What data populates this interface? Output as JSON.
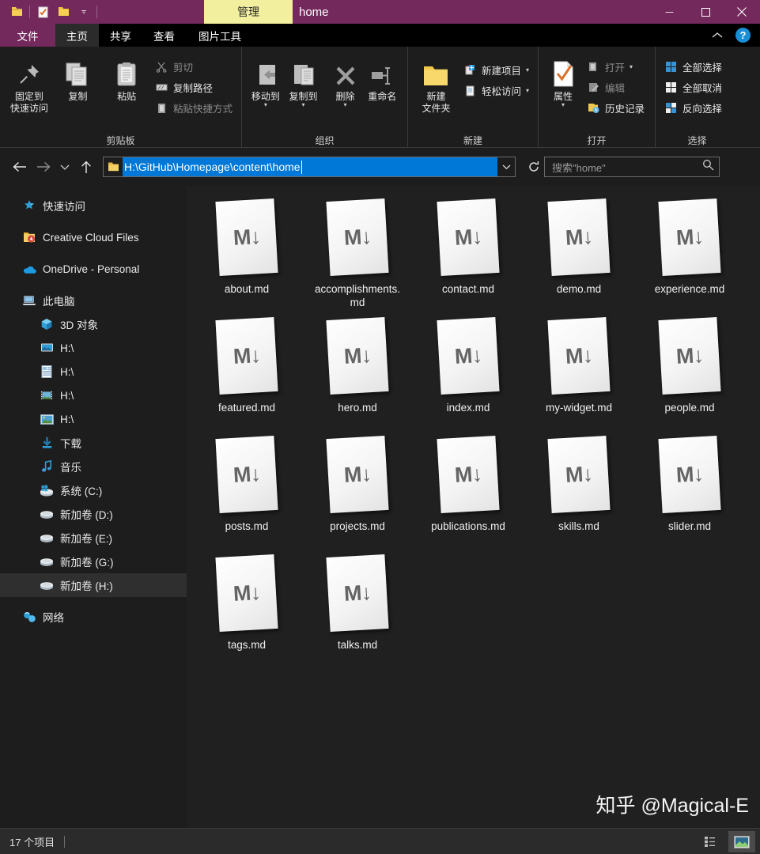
{
  "titlebar": {
    "quick_access": [
      "folder-icon",
      "properties-icon",
      "new-folder-icon",
      "customize-dropdown-icon"
    ],
    "contextual_tab": "管理",
    "window_title": "home",
    "minimize": "minimize-icon",
    "maximize": "maximize-icon",
    "close": "close-icon"
  },
  "ribbon_tabs": {
    "file": "文件",
    "items": [
      {
        "label": "主页",
        "active": true
      },
      {
        "label": "共享",
        "active": false
      },
      {
        "label": "查看",
        "active": false
      },
      {
        "label": "图片工具",
        "active": false
      }
    ],
    "collapse": "chevron-up-icon",
    "help": "?"
  },
  "ribbon": {
    "groups": [
      {
        "name": "剪贴板",
        "big": [
          {
            "label_line1": "固定到",
            "label_line2": "快速访问",
            "icon": "pin-icon"
          },
          {
            "label_line1": "复制",
            "label_line2": "",
            "icon": "copy-icon"
          },
          {
            "label_line1": "粘贴",
            "label_line2": "",
            "icon": "paste-icon"
          }
        ],
        "small": [
          {
            "label": "剪切",
            "icon": "scissors-icon",
            "disabled": true
          },
          {
            "label": "复制路径",
            "icon": "copy-path-icon",
            "disabled": false
          },
          {
            "label": "粘贴快捷方式",
            "icon": "paste-shortcut-icon",
            "disabled": true
          }
        ]
      },
      {
        "name": "组织",
        "big": [
          {
            "label_line1": "移动到",
            "label_line2": "",
            "icon": "move-to-icon",
            "dropdown": true
          },
          {
            "label_line1": "复制到",
            "label_line2": "",
            "icon": "copy-to-icon",
            "dropdown": true
          },
          {
            "label_line1": "删除",
            "label_line2": "",
            "icon": "delete-icon",
            "dropdown": true
          },
          {
            "label_line1": "重命名",
            "label_line2": "",
            "icon": "rename-icon"
          }
        ],
        "small": []
      },
      {
        "name": "新建",
        "big": [
          {
            "label_line1": "新建",
            "label_line2": "文件夹",
            "icon": "new-folder-icon"
          }
        ],
        "small": [
          {
            "label": "新建项目",
            "icon": "new-item-icon",
            "dropdown": true,
            "disabled": false
          },
          {
            "label": "轻松访问",
            "icon": "easy-access-icon",
            "dropdown": true,
            "disabled": false
          }
        ]
      },
      {
        "name": "打开",
        "big": [
          {
            "label_line1": "属性",
            "label_line2": "",
            "icon": "properties-icon",
            "dropdown": true
          }
        ],
        "small": [
          {
            "label": "打开",
            "icon": "open-icon",
            "dropdown": true,
            "disabled": true
          },
          {
            "label": "编辑",
            "icon": "edit-icon",
            "disabled": true
          },
          {
            "label": "历史记录",
            "icon": "history-icon",
            "disabled": false
          }
        ]
      },
      {
        "name": "选择",
        "big": [],
        "small": [
          {
            "label": "全部选择",
            "icon": "select-all-icon",
            "disabled": false
          },
          {
            "label": "全部取消",
            "icon": "select-none-icon",
            "disabled": false
          },
          {
            "label": "反向选择",
            "icon": "invert-selection-icon",
            "disabled": false
          }
        ]
      }
    ]
  },
  "addressbar": {
    "back": "back-arrow-icon",
    "forward": "forward-arrow-icon",
    "recent": "chevron-down-icon",
    "up": "up-arrow-icon",
    "path_icon": "folder-icon",
    "path": "H:\\GitHub\\Homepage\\content\\home",
    "dropdown": "chevron-down-icon",
    "refresh": "refresh-icon",
    "search_placeholder": "搜索\"home\"",
    "search_value": "",
    "search_icon": "search-icon"
  },
  "sidebar": {
    "items": [
      {
        "label": "快速访问",
        "icon": "star-pin-icon",
        "indent": false,
        "selected": false,
        "space_before": false
      },
      {
        "label": "Creative Cloud Files",
        "icon": "creative-cloud-icon",
        "indent": false,
        "selected": false,
        "space_before": true
      },
      {
        "label": "OneDrive - Personal",
        "icon": "onedrive-icon",
        "indent": false,
        "selected": false,
        "space_before": true
      },
      {
        "label": "此电脑",
        "icon": "this-pc-icon",
        "indent": false,
        "selected": false,
        "space_before": true
      },
      {
        "label": "3D 对象",
        "icon": "3d-objects-icon",
        "indent": true,
        "selected": false,
        "space_before": false
      },
      {
        "label": "H:\\",
        "icon": "desktop-icon",
        "indent": true,
        "selected": false,
        "space_before": false
      },
      {
        "label": "H:\\",
        "icon": "documents-icon",
        "indent": true,
        "selected": false,
        "space_before": false
      },
      {
        "label": "H:\\",
        "icon": "videos-icon",
        "indent": true,
        "selected": false,
        "space_before": false
      },
      {
        "label": "H:\\",
        "icon": "pictures-icon",
        "indent": true,
        "selected": false,
        "space_before": false
      },
      {
        "label": "下载",
        "icon": "downloads-icon",
        "indent": true,
        "selected": false,
        "space_before": false
      },
      {
        "label": "音乐",
        "icon": "music-icon",
        "indent": true,
        "selected": false,
        "space_before": false
      },
      {
        "label": "系统 (C:)",
        "icon": "system-drive-icon",
        "indent": true,
        "selected": false,
        "space_before": false
      },
      {
        "label": "新加卷 (D:)",
        "icon": "drive-icon",
        "indent": true,
        "selected": false,
        "space_before": false
      },
      {
        "label": "新加卷 (E:)",
        "icon": "drive-icon",
        "indent": true,
        "selected": false,
        "space_before": false
      },
      {
        "label": "新加卷 (G:)",
        "icon": "drive-icon",
        "indent": true,
        "selected": false,
        "space_before": false
      },
      {
        "label": "新加卷 (H:)",
        "icon": "drive-icon",
        "indent": true,
        "selected": true,
        "space_before": false
      },
      {
        "label": "网络",
        "icon": "network-icon",
        "indent": false,
        "selected": false,
        "space_before": true
      }
    ]
  },
  "files": {
    "icon_glyph": "M↓",
    "icon_name": "markdown-file-icon",
    "items": [
      {
        "name": "about.md"
      },
      {
        "name": "accomplishments.md"
      },
      {
        "name": "contact.md"
      },
      {
        "name": "demo.md"
      },
      {
        "name": "experience.md"
      },
      {
        "name": "featured.md"
      },
      {
        "name": "hero.md"
      },
      {
        "name": "index.md"
      },
      {
        "name": "my-widget.md"
      },
      {
        "name": "people.md"
      },
      {
        "name": "posts.md"
      },
      {
        "name": "projects.md"
      },
      {
        "name": "publications.md"
      },
      {
        "name": "skills.md"
      },
      {
        "name": "slider.md"
      },
      {
        "name": "tags.md"
      },
      {
        "name": "talks.md"
      }
    ]
  },
  "watermark": "知乎 @Magical-E",
  "statusbar": {
    "item_count": "17 个项目",
    "details_view": "details-view-icon",
    "large_icons_view": "large-icons-view-icon"
  },
  "colors": {
    "title_bar": "#74295d",
    "contextual_tab": "#f2f09e",
    "address_selection": "#0078d7",
    "content_bg": "#202020",
    "ribbon_bg": "#1d1d1d",
    "help_blue": "#1b8fd6"
  }
}
